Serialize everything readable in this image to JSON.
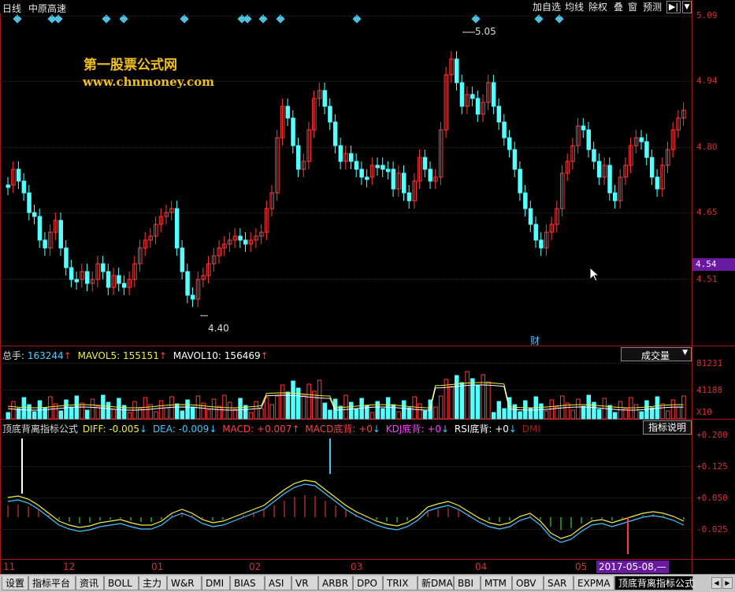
{
  "header": {
    "period": "日线",
    "stock_name": "中原高速",
    "buttons": [
      "加自选",
      "均线",
      "除权",
      "叠",
      "窗",
      "预测"
    ]
  },
  "watermark": {
    "line1": "第一股票公式网",
    "line2": "www.chnmoney.com"
  },
  "price_axis": {
    "labels": [
      "5.09",
      "4.94",
      "4.80",
      "4.65",
      "4.51"
    ],
    "current": "4.54",
    "high_label": "5.05",
    "low_label": "4.40",
    "cai_label": "财"
  },
  "volume_panel": {
    "total_label": "总手:",
    "total_value": "163244",
    "mavol5_label": "MAVOL5:",
    "mavol5_value": "155151",
    "mavol10_label": "MAVOL10:",
    "mavol10_value": "156469",
    "selector": "成交量",
    "axis": [
      "81231",
      "41188",
      "X10"
    ]
  },
  "indicator_panel": {
    "name": "顶底背离指标公式",
    "diff": "DIFF: -0.005",
    "dea": "DEA: -0.009",
    "macd": "MACD: +0.007",
    "macd_div": "MACD底背: +0",
    "kdj_div": "KDJ底背: +0",
    "rsi_div": "RSI底背: +0",
    "dmi": "DMI",
    "help_button": "指标说明",
    "axis": [
      "+0.200",
      "+0.125",
      "+0.050",
      "-0.025"
    ]
  },
  "time_axis": {
    "labels": [
      "11",
      "12",
      "01",
      "02",
      "03",
      "04",
      "05"
    ],
    "cursor_date": "2017-05-08,—"
  },
  "tabs": [
    "设置",
    "指标平台",
    "资讯",
    "BOLL",
    "主力",
    "W&R",
    "DMI",
    "BIAS",
    "ASI",
    "VR",
    "ARBR",
    "DPO",
    "TRIX",
    "新DMA",
    "BBI",
    "MTM",
    "OBV",
    "SAR",
    "EXPMA",
    "顶底背离指标公式"
  ],
  "colors": {
    "up": "#ff3b3b",
    "down": "#54ffff",
    "axis": "#d23030",
    "macd_line": "#f0f040",
    "dea_line": "#40c8ff",
    "highlight": "#6a1aa0"
  }
}
